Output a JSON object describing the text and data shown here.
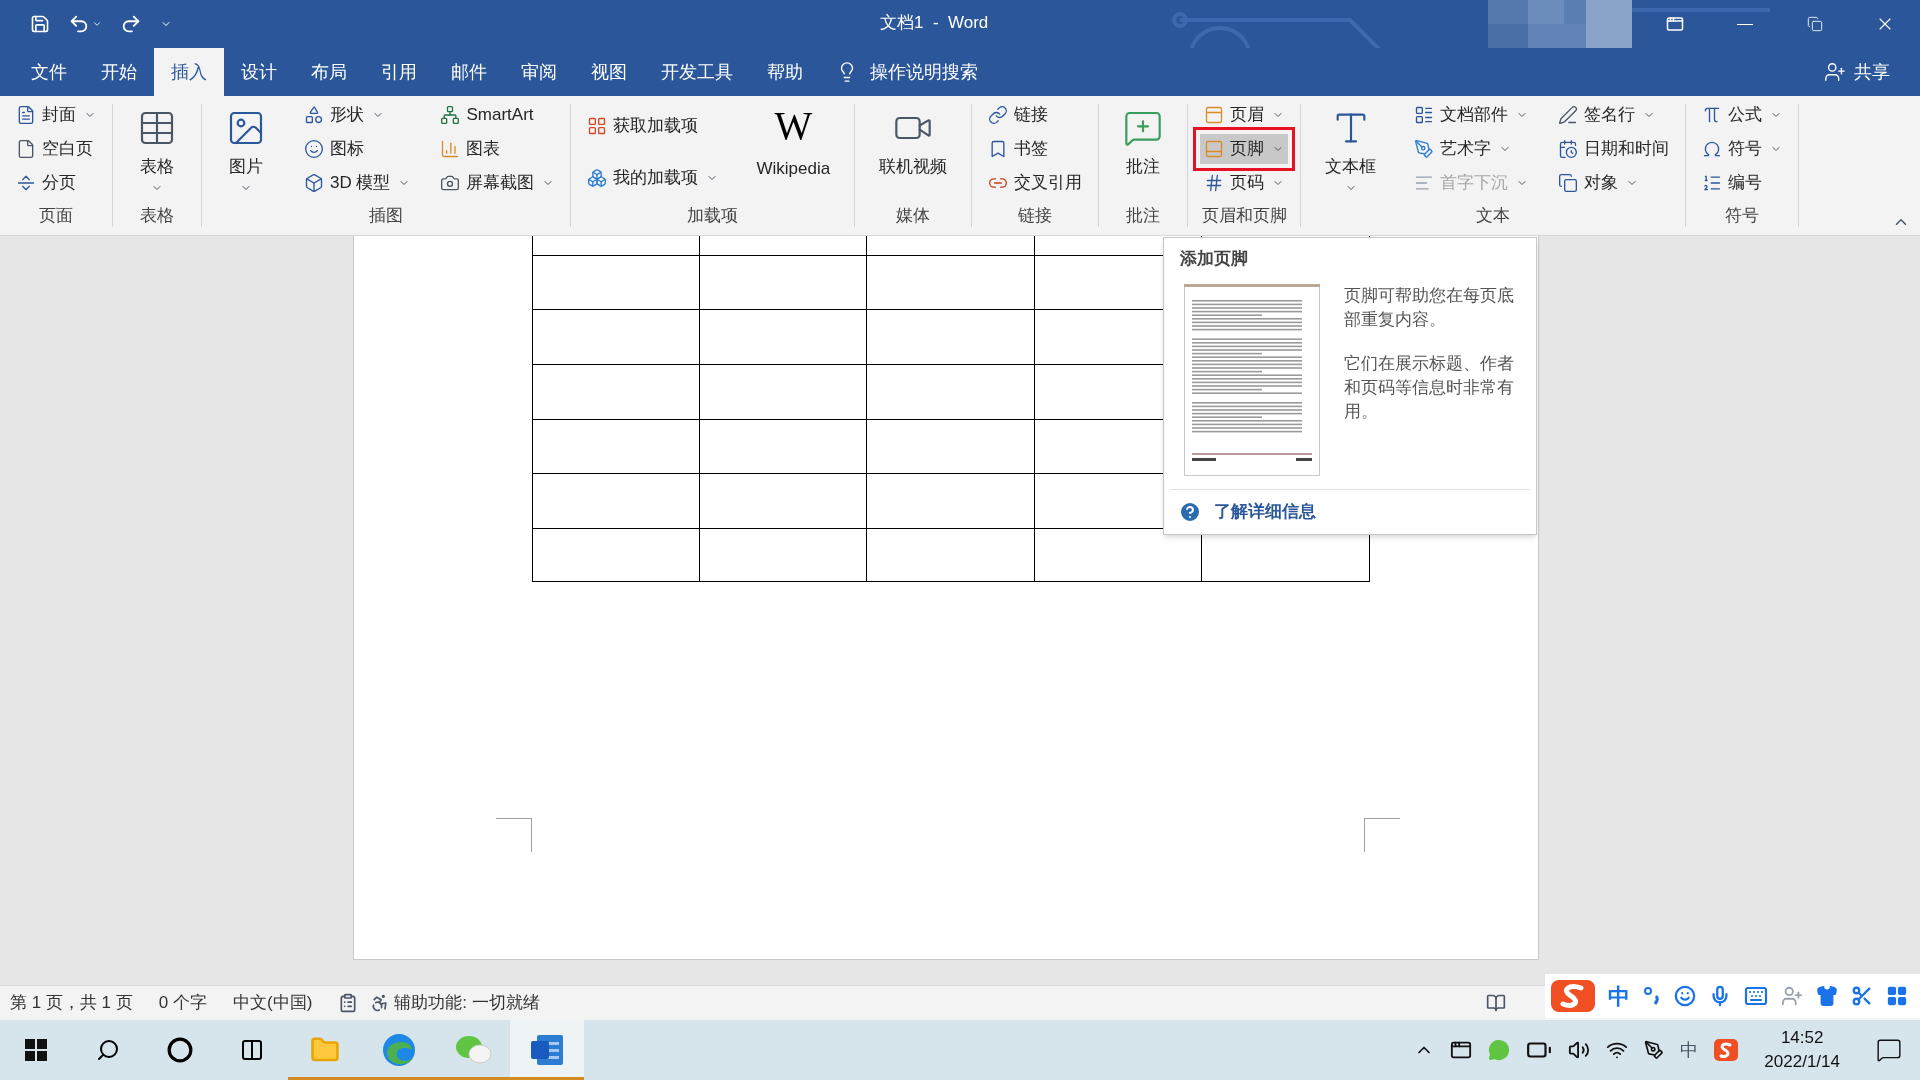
{
  "window": {
    "title": "文档1  -  Word"
  },
  "tabs": [
    {
      "label": "文件",
      "selected": false
    },
    {
      "label": "开始",
      "selected": false
    },
    {
      "label": "插入",
      "selected": true
    },
    {
      "label": "设计",
      "selected": false
    },
    {
      "label": "布局",
      "selected": false
    },
    {
      "label": "引用",
      "selected": false
    },
    {
      "label": "邮件",
      "selected": false
    },
    {
      "label": "审阅",
      "selected": false
    },
    {
      "label": "视图",
      "selected": false
    },
    {
      "label": "开发工具",
      "selected": false
    },
    {
      "label": "帮助",
      "selected": false
    }
  ],
  "tell_me": "操作说明搜索",
  "share": "共享",
  "ribbon_groups": [
    {
      "label": "页面",
      "columns": [
        [
          {
            "kind": "small",
            "label": "封面",
            "dropdown": true
          },
          {
            "kind": "small",
            "label": "空白页",
            "dropdown": false
          },
          {
            "kind": "small",
            "label": "分页",
            "dropdown": false
          }
        ]
      ]
    },
    {
      "label": "表格",
      "columns": [
        [
          {
            "kind": "large",
            "label": "表格",
            "dropdown": true
          }
        ]
      ]
    },
    {
      "label": "插图",
      "columns": [
        [
          {
            "kind": "large",
            "label": "图片",
            "dropdown": true
          }
        ],
        [
          {
            "kind": "small",
            "label": "形状",
            "dropdown": true
          },
          {
            "kind": "small",
            "label": "图标",
            "dropdown": false
          },
          {
            "kind": "small",
            "label": "3D 模型",
            "dropdown": true
          }
        ],
        [
          {
            "kind": "small",
            "label": "SmartArt",
            "dropdown": false
          },
          {
            "kind": "small",
            "label": "图表",
            "dropdown": false
          },
          {
            "kind": "small",
            "label": "屏幕截图",
            "dropdown": true
          }
        ]
      ]
    },
    {
      "label": "加载项",
      "columns": [
        [
          {
            "kind": "small",
            "label": "获取加载项",
            "dropdown": false
          },
          {
            "kind": "small",
            "label": "我的加载项",
            "dropdown": true
          }
        ],
        [
          {
            "kind": "large",
            "label": "Wikipedia",
            "logo": "W",
            "dropdown": false
          }
        ]
      ]
    },
    {
      "label": "媒体",
      "columns": [
        [
          {
            "kind": "large",
            "label": "联机视频",
            "dropdown": false
          }
        ]
      ]
    },
    {
      "label": "链接",
      "columns": [
        [
          {
            "kind": "small",
            "label": "链接",
            "dropdown": false
          },
          {
            "kind": "small",
            "label": "书签",
            "dropdown": false
          },
          {
            "kind": "small",
            "label": "交叉引用",
            "dropdown": false
          }
        ]
      ]
    },
    {
      "label": "批注",
      "columns": [
        [
          {
            "kind": "large",
            "label": "批注",
            "dropdown": false
          }
        ]
      ]
    },
    {
      "label": "页眉和页脚",
      "columns": [
        [
          {
            "kind": "small",
            "label": "页眉",
            "dropdown": true,
            "highlighted": false
          },
          {
            "kind": "small",
            "label": "页脚",
            "dropdown": true,
            "highlighted": true
          },
          {
            "kind": "small",
            "label": "页码",
            "dropdown": true,
            "highlighted": false
          }
        ]
      ]
    },
    {
      "label": "文本",
      "columns": [
        [
          {
            "kind": "large",
            "label": "文本框",
            "dropdown": true,
            "disabled": false
          }
        ],
        [
          {
            "kind": "small",
            "label": "文档部件",
            "dropdown": true,
            "disabled": false
          },
          {
            "kind": "small",
            "label": "艺术字",
            "dropdown": true,
            "disabled": false
          },
          {
            "kind": "small",
            "label": "首字下沉",
            "dropdown": true,
            "disabled": true
          }
        ],
        [
          {
            "kind": "small",
            "label": "签名行",
            "dropdown": true,
            "disabled": false
          },
          {
            "kind": "small",
            "label": "日期和时间",
            "dropdown": false,
            "disabled": false
          },
          {
            "kind": "small",
            "label": "对象",
            "dropdown": true,
            "disabled": false
          }
        ]
      ]
    },
    {
      "label": "符号",
      "columns": [
        [
          {
            "kind": "small",
            "label": "公式",
            "dropdown": true
          },
          {
            "kind": "small",
            "label": "符号",
            "dropdown": true
          },
          {
            "kind": "small",
            "label": "编号",
            "dropdown": false
          }
        ]
      ]
    }
  ],
  "tooltip": {
    "title": "添加页脚",
    "paragraphs": [
      "页脚可帮助您在每页底部重复内容。",
      "它们在展示标题、作者和页码等信息时非常有用。"
    ],
    "link": "了解详细信息"
  },
  "status_bar": {
    "page": "第 1 页，共 1 页",
    "words": "0 个字",
    "language": "中文(中国)",
    "accessibility": "辅助功能: 一切就绪"
  },
  "ime_toolbar": {
    "mode": "中"
  },
  "taskbar": {
    "apps": [
      {
        "running": true,
        "selected": false
      },
      {
        "running": true,
        "selected": false
      },
      {
        "running": true,
        "selected": false
      },
      {
        "running": true,
        "selected": true
      }
    ],
    "tray_ime": "中",
    "time": "14:52",
    "date": "2022/1/14"
  }
}
